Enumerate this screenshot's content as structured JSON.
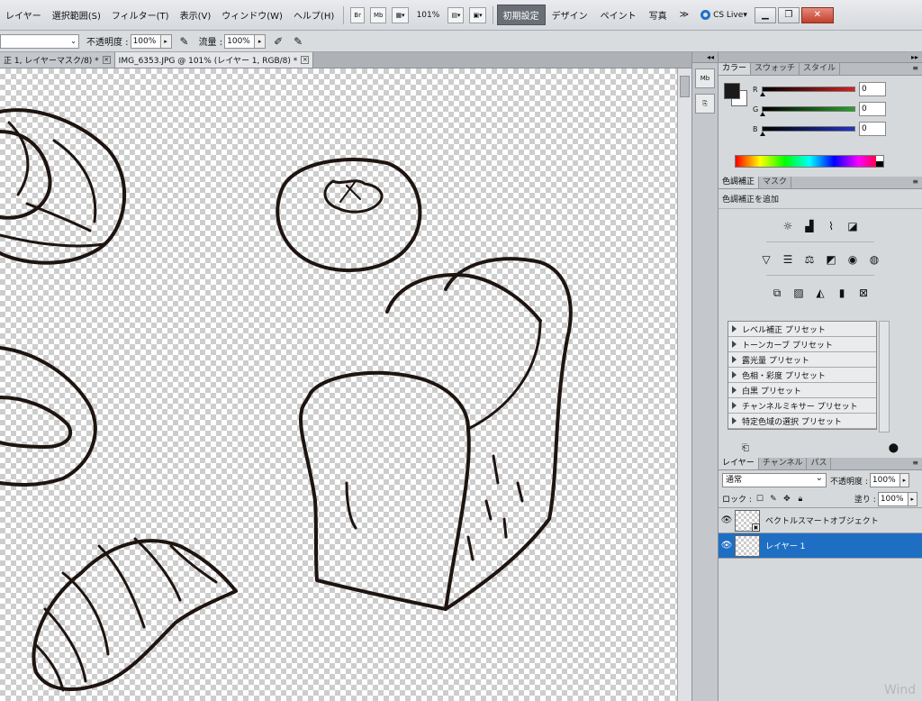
{
  "menubar": {
    "items": [
      "レイヤー",
      "選択範囲(S)",
      "フィルター(T)",
      "表示(V)",
      "ウィンドウ(W)",
      "ヘルプ(H)"
    ],
    "br_label": "Br",
    "mb_label": "Mb",
    "zoom": "101%",
    "workspaces": {
      "active": "初期設定",
      "others": [
        "デザイン",
        "ペイント",
        "写真"
      ]
    },
    "more": "≫",
    "cslive": "CS Live"
  },
  "options": {
    "opacity_label": "不透明度 :",
    "opacity_value": "100%",
    "flow_label": "流量 :",
    "flow_value": "100%"
  },
  "doc_tabs": [
    {
      "label": "正 1, レイヤーマスク/8) *",
      "active": false
    },
    {
      "label": "IMG_6353.JPG @ 101% (レイヤー 1, RGB/8) *",
      "active": true
    }
  ],
  "color_panel": {
    "tabs": [
      "カラー",
      "スウォッチ",
      "スタイル"
    ],
    "channels": [
      {
        "name": "R",
        "value": "0",
        "color": "#d42121"
      },
      {
        "name": "G",
        "value": "0",
        "color": "#27a327"
      },
      {
        "name": "B",
        "value": "0",
        "color": "#2134c8"
      }
    ]
  },
  "adjustments": {
    "tabs": [
      "色調補正",
      "マスク"
    ],
    "title": "色調補正を追加",
    "presets": [
      "レベル補正 プリセット",
      "トーンカーブ プリセット",
      "露光量 プリセット",
      "色相・彩度 プリセット",
      "白黒 プリセット",
      "チャンネルミキサー プリセット",
      "特定色域の選択 プリセット"
    ]
  },
  "layers": {
    "tabs": [
      "レイヤー",
      "チャンネル",
      "パス"
    ],
    "blend_mode": "通常",
    "opacity_label": "不透明度 :",
    "opacity_value": "100%",
    "lock_label": "ロック :",
    "fill_label": "塗り :",
    "fill_value": "100%",
    "items": [
      {
        "name": "ベクトルスマートオブジェクト",
        "selected": false,
        "smart": true
      },
      {
        "name": "レイヤー 1",
        "selected": true,
        "smart": false
      }
    ]
  },
  "watermark": "Wind"
}
